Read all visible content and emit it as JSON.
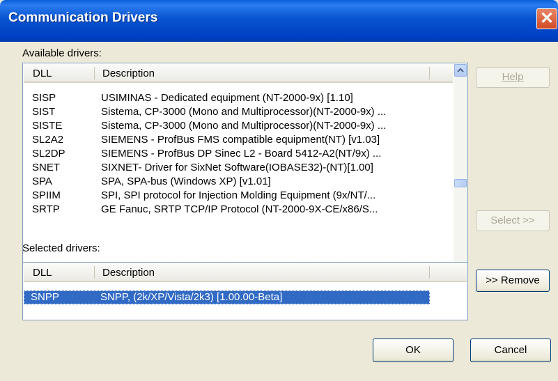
{
  "window": {
    "title": "Communication Drivers"
  },
  "available": {
    "label": "Available drivers:",
    "columns": {
      "dll": "DLL",
      "description": "Description"
    },
    "rows": [
      {
        "dll": "SISP",
        "description": "USIMINAS - Dedicated equipment (NT-2000-9x) [1.10]"
      },
      {
        "dll": "SIST",
        "description": "Sistema, CP-3000 (Mono and Multiprocessor)(NT-2000-9x) ..."
      },
      {
        "dll": "SISTE",
        "description": "Sistema, CP-3000 (Mono and Multiprocessor)(NT-2000-9x) ..."
      },
      {
        "dll": "SL2A2",
        "description": "SIEMENS - ProfBus FMS compatible equipment(NT) [v1.03]"
      },
      {
        "dll": "SL2DP",
        "description": "SIEMENS - ProfBus DP Sinec L2 - Board 5412-A2(NT/9x) ..."
      },
      {
        "dll": "SNET",
        "description": "SIXNET- Driver for SixNet Software(IOBASE32)-(NT)[1.00]"
      },
      {
        "dll": "SPA",
        "description": "SPA, SPA-bus (Windows XP) [v1.01]"
      },
      {
        "dll": "SPIIM",
        "description": "SPI, SPI protocol for Injection Molding Equipment (9x/NT/..."
      },
      {
        "dll": "SRTP",
        "description": "GE Fanuc, SRTP TCP/IP Protocol (NT-2000-9X-CE/x86/S..."
      }
    ]
  },
  "selected": {
    "label": "Selected drivers:",
    "columns": {
      "dll": "DLL",
      "description": "Description"
    },
    "rows": [
      {
        "dll": "SNPP",
        "description": "SNPP, (2k/XP/Vista/2k3) [1.00.00-Beta]"
      }
    ]
  },
  "buttons": {
    "help": "Help",
    "select": "Select >>",
    "remove": ">> Remove",
    "ok": "OK",
    "cancel": "Cancel"
  }
}
